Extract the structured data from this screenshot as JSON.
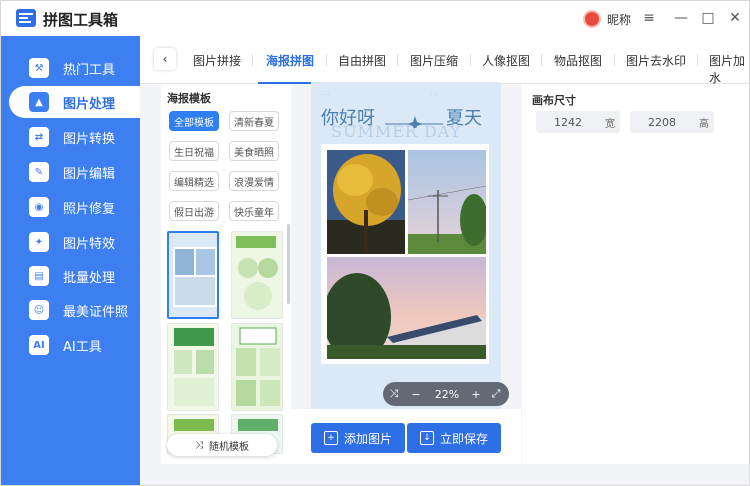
{
  "window": {
    "title": "拼图工具箱",
    "nickname": "昵称",
    "menu_icon": "≡",
    "minimize_icon": "—",
    "maximize_icon": "□",
    "close_icon": "✕"
  },
  "sidebar": {
    "items": [
      {
        "label": "热门工具",
        "icon": "tools-icon",
        "glyph": "⚒"
      },
      {
        "label": "图片处理",
        "icon": "image-process-icon",
        "glyph": "▲",
        "active": true
      },
      {
        "label": "图片转换",
        "icon": "image-convert-icon",
        "glyph": "⇄"
      },
      {
        "label": "图片编辑",
        "icon": "image-edit-icon",
        "glyph": "✎"
      },
      {
        "label": "照片修复",
        "icon": "photo-repair-icon",
        "glyph": "◉"
      },
      {
        "label": "图片特效",
        "icon": "image-effect-icon",
        "glyph": "✦"
      },
      {
        "label": "批量处理",
        "icon": "batch-icon",
        "glyph": "▤"
      },
      {
        "label": "最美证件照",
        "icon": "id-photo-icon",
        "glyph": "☺"
      },
      {
        "label": "AI工具",
        "icon": "ai-icon",
        "glyph": "AI"
      }
    ]
  },
  "tabs": {
    "back": "‹",
    "items": [
      "图片拼接",
      "海报拼图",
      "自由拼图",
      "图片压缩",
      "人像抠图",
      "物品抠图",
      "图片去水印",
      "图片加水"
    ],
    "active_index": 1
  },
  "template_panel": {
    "title": "海报模板",
    "chips": [
      "全部模板",
      "清新春夏",
      "生日祝福",
      "美食晒照",
      "编辑精选",
      "浪漫爱情",
      "假日出游",
      "快乐童年"
    ],
    "random_label": "随机模板",
    "random_icon": "⤨"
  },
  "poster": {
    "headline_left": "你好呀",
    "headline_right": "夏天",
    "ghost_text": "SUMMER DAY"
  },
  "zoom": {
    "shuffle": "⤨",
    "minus": "−",
    "value": "22%",
    "plus": "+",
    "fit": "⤢"
  },
  "actions": {
    "add_image": "添加图片",
    "save_now": "立即保存"
  },
  "canvas_size": {
    "title": "画布尺寸",
    "width": "1242",
    "width_unit": "宽",
    "height": "2208",
    "height_unit": "高"
  },
  "colors": {
    "accent": "#2f6fe6",
    "sidebar": "#3d7ff0"
  }
}
